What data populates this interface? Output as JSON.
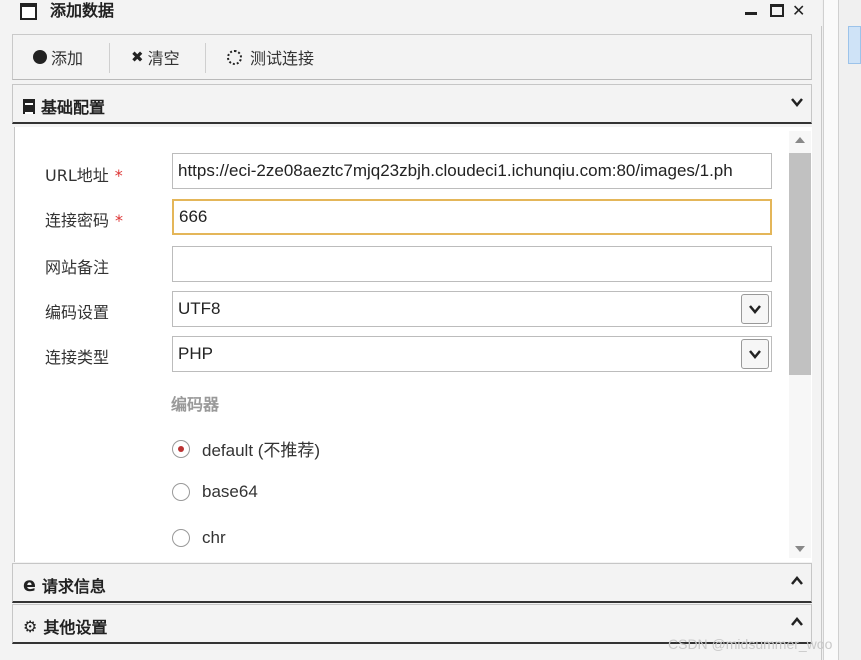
{
  "window": {
    "title": "添加数据",
    "minimize_icon": "minimize-icon",
    "maximize_icon": "maximize-icon",
    "close_icon": "close-icon"
  },
  "toolbar": {
    "add_label": "添加",
    "clear_label": "清空",
    "test_label": "测试连接"
  },
  "sections": {
    "base": {
      "title": "基础配置",
      "expanded": true
    },
    "request": {
      "title": "请求信息",
      "expanded": false
    },
    "other": {
      "title": "其他设置",
      "expanded": false
    }
  },
  "form": {
    "url": {
      "label": "URL地址",
      "required_mark": "*",
      "value": "https://eci-2ze08aeztc7mjq23zbjh.cloudeci1.ichunqiu.com:80/images/1.ph"
    },
    "password": {
      "label": "连接密码",
      "required_mark": "*",
      "value": "666"
    },
    "note": {
      "label": "网站备注",
      "value": ""
    },
    "encoding": {
      "label": "编码设置",
      "value": "UTF8"
    },
    "type": {
      "label": "连接类型",
      "value": "PHP"
    },
    "encoder": {
      "label": "编码器",
      "options": [
        "default (不推荐)",
        "base64",
        "chr"
      ],
      "selected_index": 0
    }
  },
  "watermark": "CSDN @midsummer_woo",
  "colors": {
    "focus_border": "#e4b659",
    "required": "#dd3333",
    "radio_selected": "#b33333"
  }
}
